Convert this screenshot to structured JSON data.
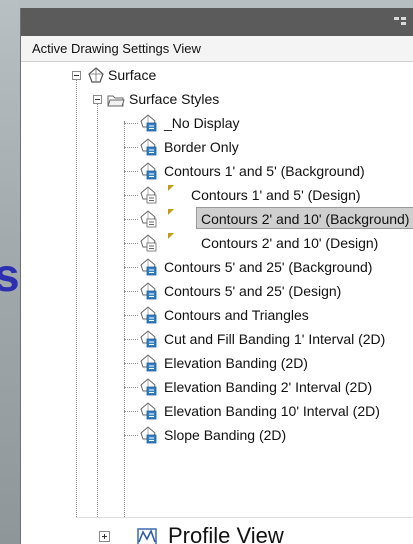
{
  "panel": {
    "header": "Active Drawing Settings View"
  },
  "tree": {
    "surface": {
      "label": "Surface"
    },
    "surface_styles": {
      "label": "Surface Styles"
    },
    "items": [
      "_No Display",
      "Border Only",
      "Contours 1' and 5' (Background)",
      "Contours 1' and 5' (Design)",
      "Contours 2' and 10' (Background)",
      "Contours 2' and 10' (Design)",
      "Contours 5' and 25' (Background)",
      "Contours 5' and 25' (Design)",
      "Contours and Triangles",
      "Cut and Fill Banding 1' Interval (2D)",
      "Elevation Banding (2D)",
      "Elevation Banding 2' Interval (2D)",
      "Elevation Banding 10' Interval (2D)",
      "Slope Banding (2D)"
    ],
    "profile_view": {
      "label": "Profile View"
    }
  },
  "colors": {
    "selection": "#cfcfcf",
    "flag": "#c79a16",
    "style_icon": "#2f7fc1"
  },
  "icons": {
    "surface": "surface-icon",
    "folder": "folder-icon",
    "style": "style-icon",
    "profile_view": "profile-view-icon"
  },
  "background": {
    "partial_letter": "s"
  }
}
